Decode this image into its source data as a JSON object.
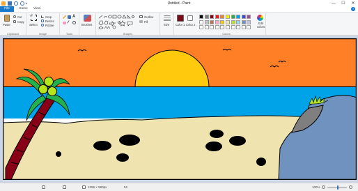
{
  "window": {
    "title": "Untitled - Paint",
    "minimize": "—",
    "maximize": "☐",
    "close": "✕"
  },
  "tabs": [
    {
      "label": "File"
    },
    {
      "label": "Home"
    },
    {
      "label": "View"
    }
  ],
  "ribbon": {
    "clipboard": {
      "label": "Clipboard",
      "paste": "Paste",
      "cut": "Cut",
      "copy": "Copy"
    },
    "image": {
      "label": "Image",
      "select": "Select",
      "crop": "Crop",
      "resize": "Resize",
      "rotate": "Rotate"
    },
    "tools": {
      "label": "Tools"
    },
    "brushes": {
      "label": "Brushes"
    },
    "shapes": {
      "label": "Shapes",
      "outline": "Outline",
      "fill": "Fill"
    },
    "size": {
      "label": "Size"
    },
    "color1": {
      "label": "Color 1",
      "value": "#7a0c1a"
    },
    "color2": {
      "label": "Color 2",
      "value": "#ffffff"
    },
    "colors": {
      "label": "Colors"
    },
    "edit_colors": "Edit colors"
  },
  "palette": {
    "row1": [
      "#000000",
      "#7f7f7f",
      "#880015",
      "#ed1c24",
      "#ff7f27",
      "#fff200",
      "#22b14c",
      "#00a2e8",
      "#3f48cc",
      "#a349a4"
    ],
    "row2": [
      "#ffffff",
      "#c3c3c3",
      "#b97a57",
      "#ffaec9",
      "#ffc90e",
      "#efe4b0",
      "#b5e61d",
      "#99d9ea",
      "#7092be",
      "#c8bfe7"
    ],
    "row3": [
      "#ffffff",
      "#ffffff",
      "#ffffff",
      "#ffffff",
      "#ffffff",
      "#ffffff",
      "#ffffff",
      "#ffffff",
      "#ffffff",
      "#ffffff"
    ]
  },
  "statusbar": {
    "size": "1359 × 590px",
    "zoom": "100%",
    "file_size": "52"
  }
}
